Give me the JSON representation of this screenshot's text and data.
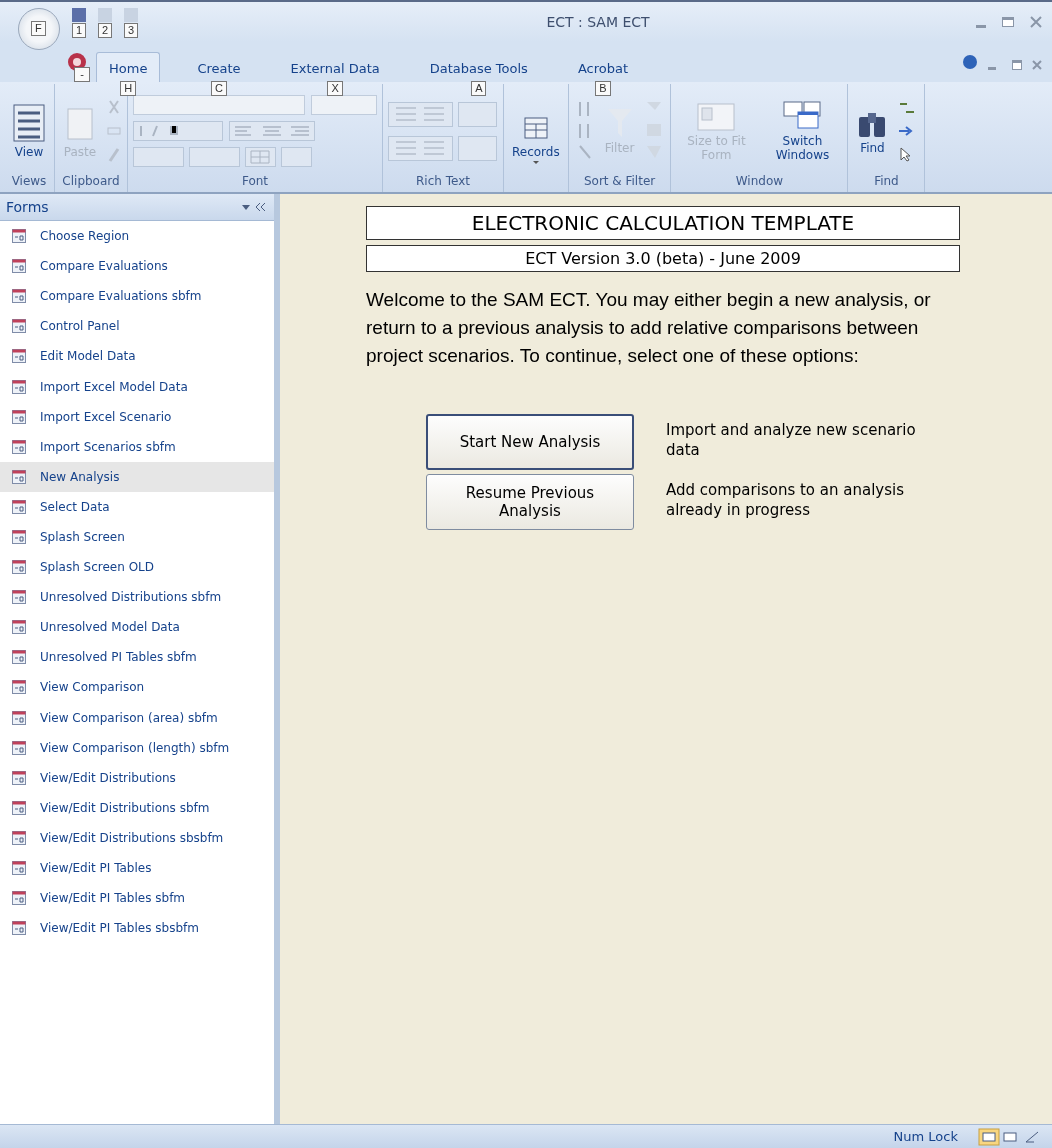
{
  "window": {
    "title": "ECT : SAM ECT",
    "office_key_tip": "F",
    "app_key_tip": "-",
    "quick_access_key_tips": [
      "1",
      "2",
      "3"
    ]
  },
  "tabs": [
    {
      "label": "Home",
      "key_tip": "H",
      "selected": true
    },
    {
      "label": "Create",
      "key_tip": "C",
      "selected": false
    },
    {
      "label": "External Data",
      "key_tip": "X",
      "selected": false
    },
    {
      "label": "Database Tools",
      "key_tip": "A",
      "selected": false
    },
    {
      "label": "Acrobat",
      "key_tip": "B",
      "selected": false
    }
  ],
  "ribbon": [
    {
      "label": "Views",
      "kind": "views",
      "buttons": [
        {
          "label": "View",
          "disabled": false
        }
      ]
    },
    {
      "label": "Clipboard",
      "kind": "clipboard",
      "buttons": [
        {
          "label": "Paste",
          "disabled": true
        }
      ]
    },
    {
      "label": "Font",
      "kind": "font"
    },
    {
      "label": "Rich Text",
      "kind": "richtext"
    },
    {
      "kind": "records",
      "buttons": [
        {
          "label": "Records",
          "disabled": false
        }
      ]
    },
    {
      "label": "Sort & Filter",
      "kind": "sort",
      "buttons": [
        {
          "label": "Filter",
          "disabled": true
        }
      ]
    },
    {
      "label": "Window",
      "kind": "window",
      "buttons": [
        {
          "label": "Size to Fit Form",
          "disabled": true
        },
        {
          "label": "Switch Windows",
          "disabled": false
        }
      ]
    },
    {
      "label": "Find",
      "kind": "find",
      "buttons": [
        {
          "label": "Find",
          "disabled": false
        }
      ]
    }
  ],
  "nav_pane": {
    "title": "Forms",
    "items": [
      {
        "label": "Choose Region",
        "selected": false
      },
      {
        "label": "Compare Evaluations",
        "selected": false
      },
      {
        "label": "Compare Evaluations sbfm",
        "selected": false
      },
      {
        "label": "Control Panel",
        "selected": false
      },
      {
        "label": "Edit Model Data",
        "selected": false
      },
      {
        "label": "Import Excel Model Data",
        "selected": false
      },
      {
        "label": "Import Excel Scenario",
        "selected": false
      },
      {
        "label": "Import Scenarios sbfm",
        "selected": false
      },
      {
        "label": "New Analysis",
        "selected": true
      },
      {
        "label": "Select Data",
        "selected": false
      },
      {
        "label": "Splash Screen",
        "selected": false
      },
      {
        "label": "Splash Screen OLD",
        "selected": false
      },
      {
        "label": "Unresolved Distributions sbfm",
        "selected": false
      },
      {
        "label": "Unresolved Model Data",
        "selected": false
      },
      {
        "label": "Unresolved PI Tables sbfm",
        "selected": false
      },
      {
        "label": "View Comparison",
        "selected": false
      },
      {
        "label": "View Comparison (area) sbfm",
        "selected": false
      },
      {
        "label": "View Comparison (length) sbfm",
        "selected": false
      },
      {
        "label": "View/Edit Distributions",
        "selected": false
      },
      {
        "label": "View/Edit Distributions sbfm",
        "selected": false
      },
      {
        "label": "View/Edit Distributions sbsbfm",
        "selected": false
      },
      {
        "label": "View/Edit PI Tables",
        "selected": false
      },
      {
        "label": "View/Edit PI Tables sbfm",
        "selected": false
      },
      {
        "label": "View/Edit PI Tables sbsbfm",
        "selected": false
      }
    ]
  },
  "form": {
    "title": "ELECTRONIC CALCULATION TEMPLATE",
    "version": "ECT Version 3.0 (beta) - June 2009",
    "welcome": "Welcome to the SAM ECT. You may either begin a new analysis, or return to a previous analysis to add relative comparisons between project scenarios. To continue, select one of these options:",
    "actions": [
      {
        "button": "Start New Analysis",
        "description": "Import and analyze new scenario data",
        "focused": true
      },
      {
        "button": "Resume Previous Analysis",
        "description": "Add comparisons to an analysis already in progress",
        "focused": false
      }
    ]
  },
  "status_bar": {
    "indicator": "Num Lock"
  }
}
